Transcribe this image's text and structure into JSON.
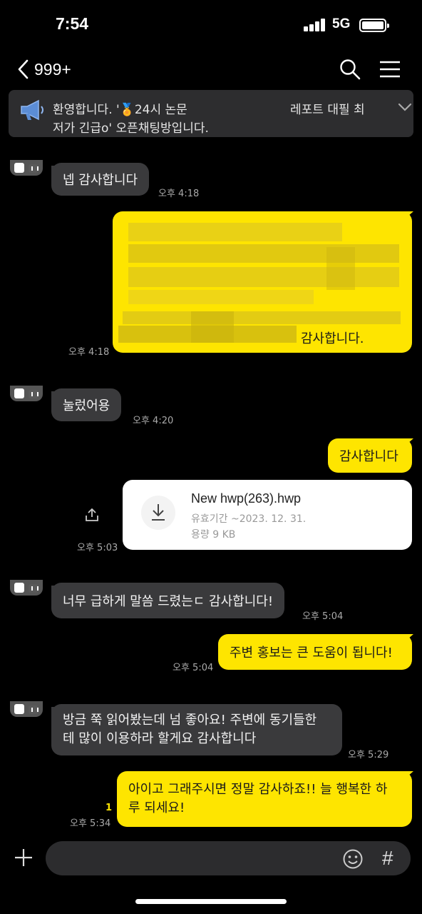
{
  "status": {
    "time": "7:54",
    "network": "5G"
  },
  "header": {
    "back_count": "999+"
  },
  "notice": {
    "line1": "환영합니다. '🏅24시 논문",
    "line1b": "레포트 대필 최",
    "line2": "저가 긴급o' 오픈채팅방입니다."
  },
  "messages": {
    "m1": {
      "text": "넵 감사합니다",
      "time": "오후 4:18"
    },
    "m2": {
      "visible_text": "감사합니다.",
      "time": "오후 4:18"
    },
    "m3": {
      "text": "눌렀어용",
      "time": "오후 4:20"
    },
    "m4": {
      "text": "감사합니다"
    },
    "file": {
      "name": "New hwp(263).hwp",
      "expiry": "유효기간 ~2023. 12. 31.",
      "size": "용량  9 KB",
      "time": "오후 5:03"
    },
    "m5": {
      "text": "너무 급하게 말씀 드렸는ㄷ 감사합니다!",
      "time": "오후 5:04"
    },
    "m6": {
      "text": "주변 홍보는 큰 도움이 됩니다!",
      "time": "오후 5:04"
    },
    "m7": {
      "line1": "방금 쭉 읽어봤는데 넘 좋아요! 주변에 동기들한",
      "line2": "테 많이 이용하라 할게요 감사합니다",
      "time": "오후 5:29"
    },
    "m8": {
      "line1": "아이고 그래주시면 정말 감사하죠!! 늘 행복한 하",
      "line2": "루 되세요!",
      "time": "오후 5:34",
      "unread": "1"
    }
  },
  "input": {
    "placeholder": ""
  },
  "colors": {
    "outgoing": "#fee500",
    "incoming": "#3a3a3c",
    "background": "#000000"
  }
}
